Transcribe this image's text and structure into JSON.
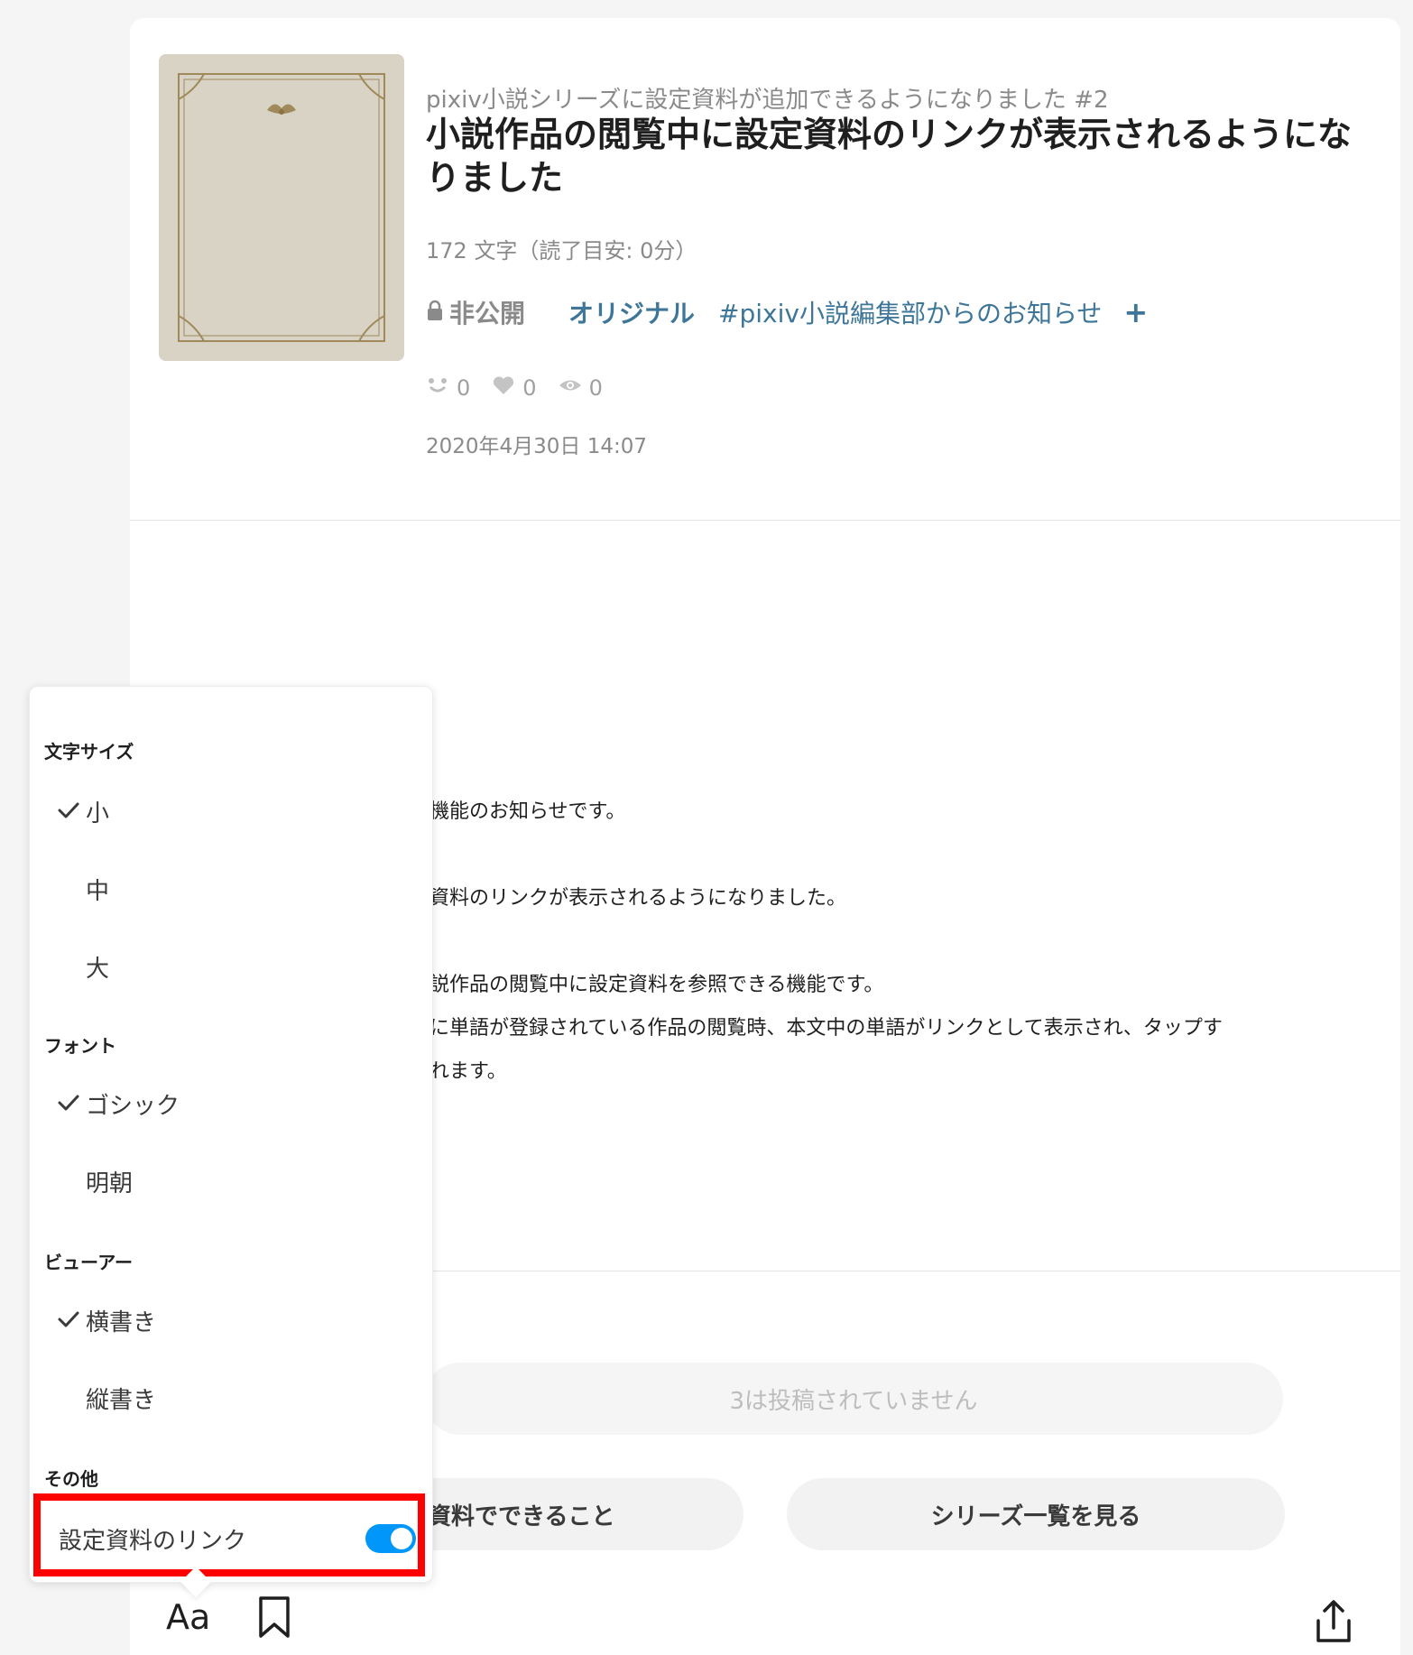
{
  "header": {
    "series_title": "pixiv小説シリーズに設定資料が追加できるようになりました #2",
    "work_title": "小説作品の閲覧中に設定資料のリンクが表示されるようになりました",
    "char_count": "172 文字（読了目安: 0分）",
    "visibility": "非公開",
    "tag_original": "オリジナル",
    "tag_hash": "#pixiv小説編集部からのお知らせ",
    "tag_add": "+",
    "stats": {
      "likes": "0",
      "bookmarks": "0",
      "views": "0"
    },
    "posted_date": "2020年4月30日 14:07"
  },
  "body": {
    "lines": [
      "新機能のお知らせです。",
      "",
      "定資料のリンクが表示されるようになりました。",
      "",
      "小説作品の閲覧中に設定資料を参照できる機能です。",
      "料に単語が登録されている作品の閲覧時、本文中の単語がリンクとして表示され、タップす",
      "されます。"
    ]
  },
  "footer": {
    "next_disabled": "3は投稿されていません",
    "btn_whatcando": "資料でできること",
    "btn_series": "シリーズ一覧を見る"
  },
  "toolbar": {
    "font_toggle": "Aa"
  },
  "settings_popover": {
    "font_size_heading": "文字サイズ",
    "font_sizes": [
      {
        "label": "小",
        "checked": true
      },
      {
        "label": "中",
        "checked": false
      },
      {
        "label": "大",
        "checked": false
      }
    ],
    "font_heading": "フォント",
    "fonts": [
      {
        "label": "ゴシック",
        "checked": true
      },
      {
        "label": "明朝",
        "checked": false
      }
    ],
    "viewer_heading": "ビューアー",
    "viewers": [
      {
        "label": "横書き",
        "checked": true
      },
      {
        "label": "縦書き",
        "checked": false
      }
    ],
    "other_heading": "その他",
    "setting_link_label": "設定資料のリンク",
    "setting_link_enabled": true
  },
  "colors": {
    "accent_blue": "#0096fa",
    "tag_blue": "#3d7699",
    "highlight_red": "#ff0000"
  },
  "icons": [
    "lock-icon",
    "like-icon",
    "heart-icon",
    "eye-icon",
    "check-icon",
    "bookmark-icon",
    "share-icon"
  ]
}
